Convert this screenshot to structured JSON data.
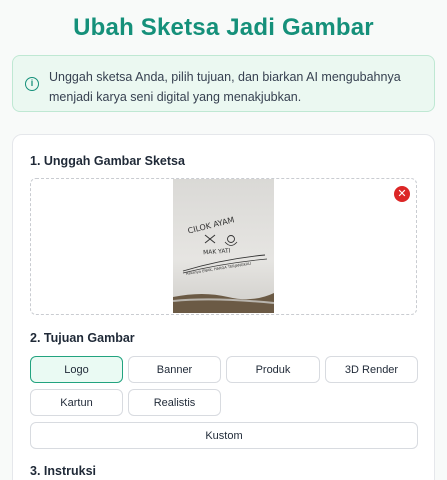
{
  "page": {
    "title": "Ubah Sketsa Jadi Gambar",
    "info": "Unggah sketsa Anda, pilih tujuan, dan biarkan AI mengubahnya menjadi karya seni digital yang menakjubkan."
  },
  "upload": {
    "label": "1. Unggah Gambar Sketsa",
    "remove_icon": "close-icon",
    "sketch_text": {
      "line1": "CILOK AYAM",
      "line2": "MAK YATI",
      "line3": "Rasanya ENAK, HARGA TERJANGKAU"
    }
  },
  "purpose": {
    "label": "2. Tujuan Gambar",
    "options": [
      {
        "label": "Logo",
        "selected": true
      },
      {
        "label": "Banner",
        "selected": false
      },
      {
        "label": "Produk",
        "selected": false
      },
      {
        "label": "3D Render",
        "selected": false
      },
      {
        "label": "Kartun",
        "selected": false
      },
      {
        "label": "Realistis",
        "selected": false
      },
      {
        "label": "Kustom",
        "selected": false
      }
    ]
  },
  "instructions": {
    "label": "3. Instruksi"
  },
  "colors": {
    "brand": "#15907a",
    "remove": "#dc2626",
    "selected_border": "#22a37f"
  }
}
